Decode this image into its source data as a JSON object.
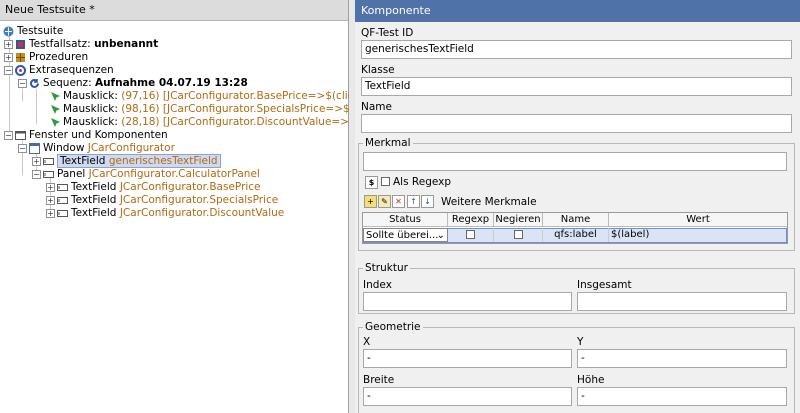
{
  "left": {
    "title": "Neue Testsuite *"
  },
  "tree": {
    "testsuite": "Testsuite",
    "testfallsatz_prefix": "Testfallsatz:",
    "testfallsatz_name": "unbenannt",
    "prozeduren": "Prozeduren",
    "extrasequenzen": "Extrasequenzen",
    "sequenz_prefix": "Sequenz:",
    "sequenz_name": "Aufnahme 04.07.19 13:28",
    "mausklicks": [
      {
        "label": "Mausklick:",
        "coords": "(97,16)",
        "target": "[JCarConfigurator.BasePrice=>$(client)]"
      },
      {
        "label": "Mausklick:",
        "coords": "(98,16)",
        "target": "[JCarConfigurator.SpecialsPrice=>$(client)]"
      },
      {
        "label": "Mausklick:",
        "coords": "(28,18)",
        "target": "[JCarConfigurator.DiscountValue=>$(client)]"
      }
    ],
    "fenster": "Fenster und Komponenten",
    "window_label": "Window",
    "window_name": "JCarConfigurator",
    "selected_label": "TextField",
    "selected_name": "generischesTextField",
    "panel_label": "Panel",
    "panel_name": "JCarConfigurator.CalculatorPanel",
    "panel_children": [
      {
        "label": "TextField",
        "name": "JCarConfigurator.BasePrice"
      },
      {
        "label": "TextField",
        "name": "JCarConfigurator.SpecialsPrice"
      },
      {
        "label": "TextField",
        "name": "JCarConfigurator.DiscountValue"
      }
    ]
  },
  "right": {
    "title": "Komponente",
    "qftest_id_label": "QF-Test ID",
    "qftest_id_value": "generischesTextField",
    "klasse_label": "Klasse",
    "klasse_value": "TextField",
    "name_label": "Name",
    "name_value": "",
    "merkmal_legend": "Merkmal",
    "merkmal_value": "",
    "regexp_icon_text": "$",
    "als_regexp": "Als Regexp",
    "weitere_merkmale": "Weitere Merkmale",
    "table": {
      "headers": [
        "Status",
        "Regexp",
        "Negieren",
        "Name",
        "Wert"
      ],
      "row": {
        "status": "Sollte überei...",
        "name": "qfs:label",
        "wert": "$(label)"
      }
    },
    "struktur_legend": "Struktur",
    "index_label": "Index",
    "index_value": "",
    "insgesamt_label": "Insgesamt",
    "insgesamt_value": "",
    "geometrie_legend": "Geometrie",
    "x_label": "X",
    "x_value": "-",
    "y_label": "Y",
    "y_value": "-",
    "breite_label": "Breite",
    "breite_value": "-",
    "hoehe_label": "Höhe",
    "hoehe_value": "-"
  },
  "colors": {
    "accent": "#4f73a8",
    "name_orange": "#b06a10",
    "selection": "#cfd9f0"
  }
}
